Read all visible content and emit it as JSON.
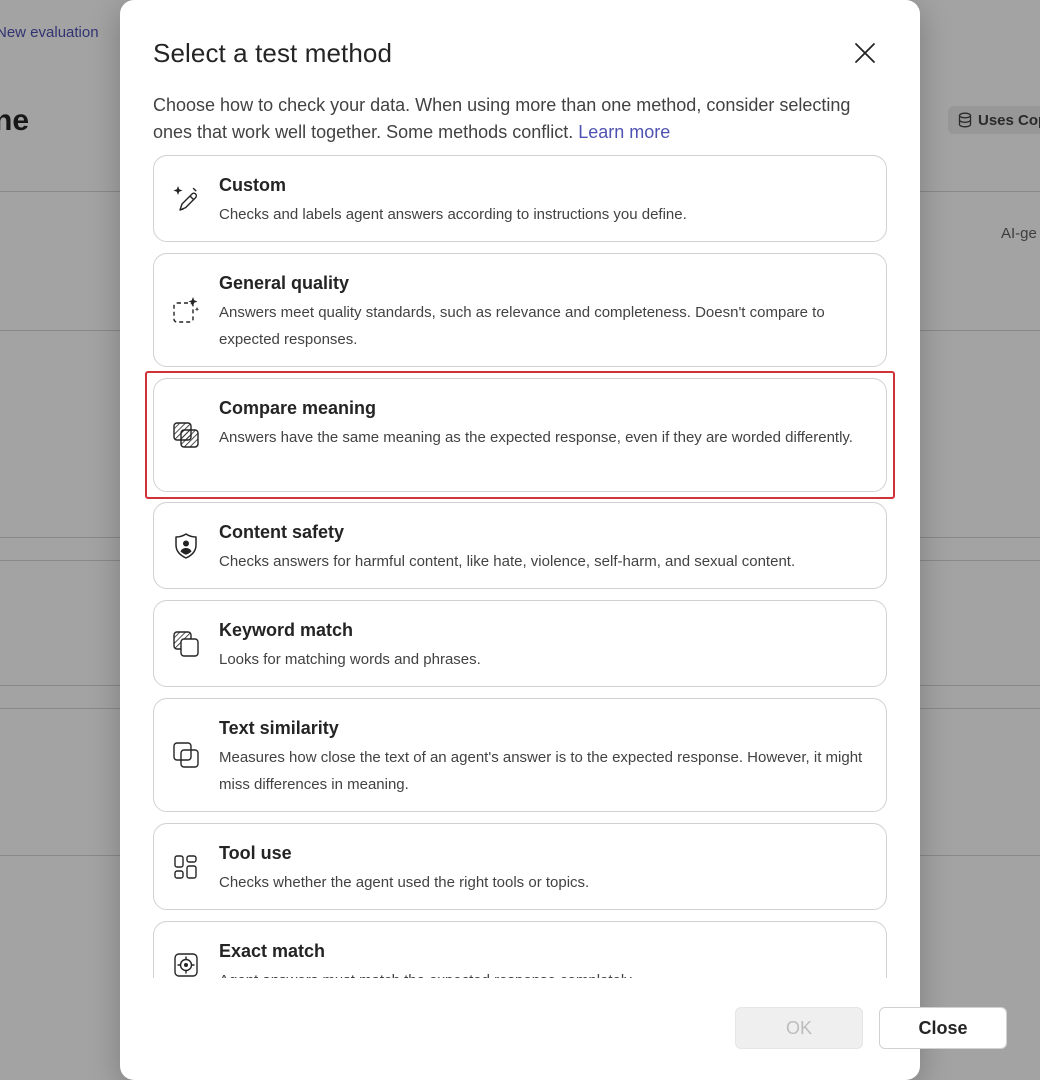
{
  "background": {
    "link": "New evaluation",
    "title": "ne",
    "badge": "Uses Cop",
    "ai_label": "AI-ge"
  },
  "dialog": {
    "title": "Select a test method",
    "description": "Choose how to check your data. When using more than one method, consider selecting ones that work well together. Some methods conflict.",
    "learn_more": "Learn more",
    "ok_label": "OK",
    "close_label": "Close"
  },
  "methods": [
    {
      "icon": "custom-sparkle-pen-icon",
      "name": "Custom",
      "description": "Checks and labels agent answers according to instructions you define."
    },
    {
      "icon": "general-quality-sparkle-icon",
      "name": "General quality",
      "description": "Answers meet quality standards, such as relevance and completeness. Doesn't compare to expected responses."
    },
    {
      "icon": "compare-meaning-icon",
      "name": "Compare meaning",
      "description": "Answers have the same meaning as the expected response, even if they are worded differently."
    },
    {
      "icon": "content-safety-shield-icon",
      "name": "Content safety",
      "description": "Checks answers for harmful content, like hate, violence, self-harm, and sexual content."
    },
    {
      "icon": "keyword-match-icon",
      "name": "Keyword match",
      "description": "Looks for matching words and phrases."
    },
    {
      "icon": "text-similarity-icon",
      "name": "Text similarity",
      "description": "Measures how close the text of an agent's answer is to the expected response. However, it might miss differences in meaning."
    },
    {
      "icon": "tool-use-icon",
      "name": "Tool use",
      "description": "Checks whether the agent used the right tools or topics."
    },
    {
      "icon": "exact-match-target-icon",
      "name": "Exact match",
      "description": "Agent answers must match the expected response completely."
    }
  ],
  "highlighted_method": "Compare meaning",
  "colors": {
    "accent": "#4f52b2",
    "highlight_border": "#d13438",
    "card_border": "#d1d1d1"
  }
}
